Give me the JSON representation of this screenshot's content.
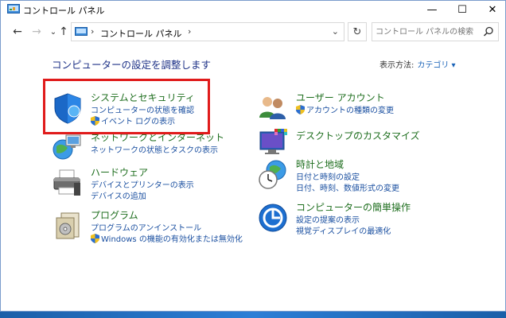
{
  "window": {
    "title": "コントロール パネル",
    "minimize": "—",
    "maximize": "☐",
    "close": "✕"
  },
  "nav": {
    "back": "←",
    "forward": "→",
    "recent": "⌄",
    "up": "↑",
    "breadcrumb": "コントロール パネル",
    "refresh": "↻",
    "search_placeholder": "コントロール パネルの検索"
  },
  "main": {
    "heading": "コンピューターの設定を調整します",
    "view_by_label": "表示方法:",
    "view_by_value": "カテゴリ ▾",
    "categories_left": [
      {
        "title": "システムとセキュリティ",
        "links": [
          "コンピューターの状態を確認",
          "イベント ログの表示"
        ],
        "icon": "shield-icon"
      },
      {
        "title": "ネットワークとインターネット",
        "links": [
          "ネットワークの状態とタスクの表示"
        ],
        "icon": "network-globe-icon"
      },
      {
        "title": "ハードウェア",
        "links": [
          "デバイスとプリンターの表示",
          "デバイスの追加"
        ],
        "icon": "printer-icon"
      },
      {
        "title": "プログラム",
        "links": [
          "プログラムのアンインストール",
          "Windows の機能の有効化または無効化"
        ],
        "icon": "programs-icon"
      }
    ],
    "categories_right": [
      {
        "title": "ユーザー アカウント",
        "links": [
          "アカウントの種類の変更"
        ],
        "icon": "users-icon"
      },
      {
        "title": "デスクトップのカスタマイズ",
        "links": [],
        "icon": "desktop-icon"
      },
      {
        "title": "時計と地域",
        "links": [
          "日付と時刻の設定",
          "日付、時刻、数値形式の変更"
        ],
        "icon": "clock-globe-icon"
      },
      {
        "title": "コンピューターの簡単操作",
        "links": [
          "設定の提案の表示",
          "視覚ディスプレイの最適化"
        ],
        "icon": "accessibility-icon"
      }
    ]
  },
  "colors": {
    "category_title": "#1e6e1e",
    "link": "#1a4fa0",
    "heading": "#1e3287",
    "highlight": "#e01b1b"
  }
}
